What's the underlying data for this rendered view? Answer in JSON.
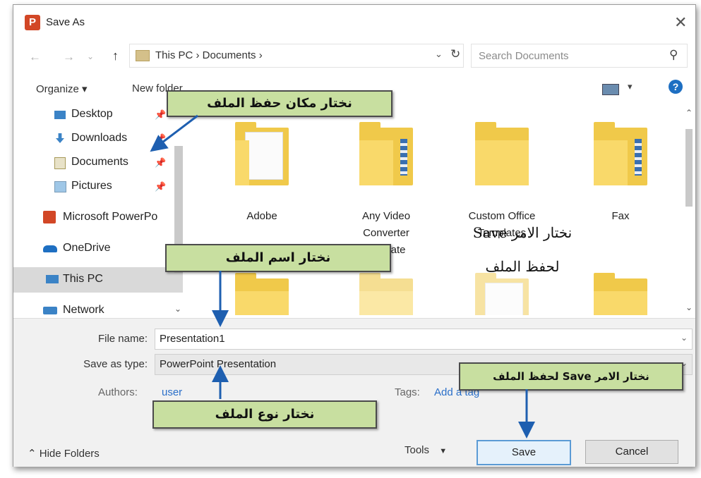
{
  "window": {
    "title": "Save As",
    "close": "✕"
  },
  "address": {
    "path": "This PC  ›  Documents  ›",
    "dropdown": "⌄",
    "refresh": "↻",
    "back": "←",
    "forward": "→",
    "up": "↑"
  },
  "search": {
    "placeholder": "Search Documents",
    "icon": "⚲"
  },
  "toolbar": {
    "organize": "Organize ▾",
    "new_folder": "New folder",
    "view_dropdown": "▾",
    "help": "?"
  },
  "nav": {
    "items": [
      {
        "label": "Desktop",
        "icon": "desktop-icon",
        "pinned": true
      },
      {
        "label": "Downloads",
        "icon": "download-icon",
        "pinned": true
      },
      {
        "label": "Documents",
        "icon": "documents-icon",
        "pinned": true
      },
      {
        "label": "Pictures",
        "icon": "pictures-icon",
        "pinned": true
      },
      {
        "label": "Microsoft PowerPo",
        "icon": "powerpoint-icon"
      },
      {
        "label": "OneDrive",
        "icon": "onedrive-icon"
      },
      {
        "label": "This PC",
        "icon": "this-pc-icon",
        "selected": true
      },
      {
        "label": "Network",
        "icon": "network-icon"
      }
    ],
    "pin_glyph": "📌"
  },
  "folders": [
    {
      "label": "Adobe"
    },
    {
      "label": "Any Video Converter Ultimate"
    },
    {
      "label": "Custom Office Templates"
    },
    {
      "label": "Fax"
    }
  ],
  "form": {
    "file_name_label": "File name:",
    "file_name_value": "Presentation1",
    "save_type_label": "Save as type:",
    "save_type_value": "PowerPoint Presentation",
    "authors_label": "Authors:",
    "authors_value": "user",
    "tags_label": "Tags:",
    "tags_value": "Add a tag"
  },
  "footer": {
    "hide_folders": "Hide Folders",
    "hide_glyph": "⌃",
    "tools": "Tools",
    "tools_dd": "▼",
    "save": "Save",
    "cancel": "Cancel"
  },
  "annotations": {
    "location": "نختار مكان حفظ الملف",
    "name": "نختار اسم الملف",
    "type": "نختار نوع الملف",
    "save_box": "نختار الامر Save لحفظ الملف",
    "save_note_line1": "نختار الامر Save",
    "save_note_line2": "لحفظ الملف"
  }
}
